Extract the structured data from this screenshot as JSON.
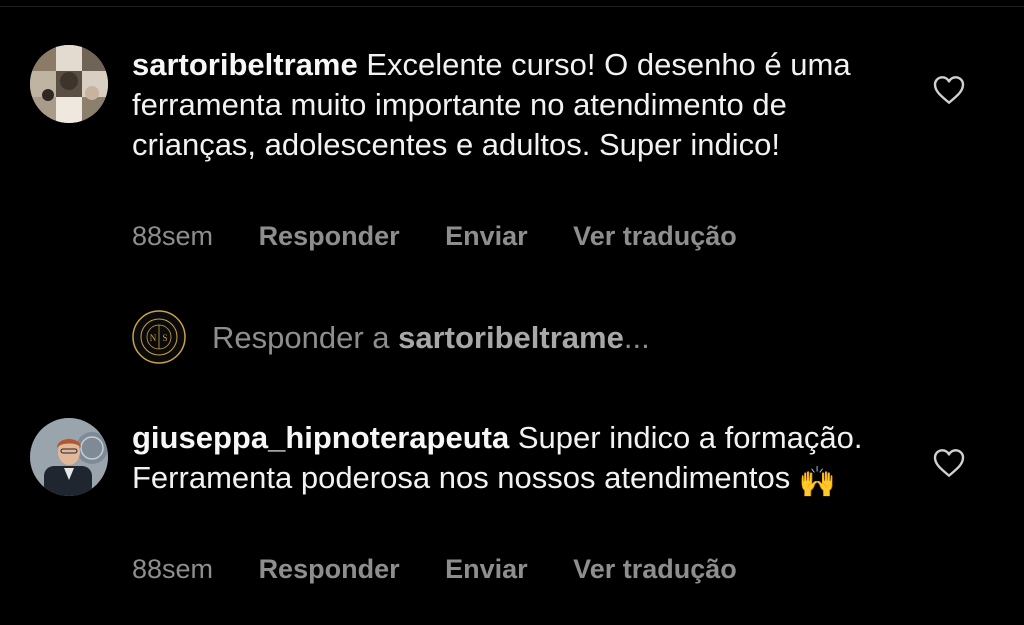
{
  "comments": [
    {
      "username": "sartoribeltrame",
      "text": "Excelente curso! O desenho é uma ferramenta muito importante no atendimento de crianças, adolescentes e adultos.  Super indico!",
      "time": "88sem",
      "reply_label": "Responder",
      "send_label": "Enviar",
      "translate_label": "Ver tradução",
      "avatar_icon": "profile-collage-avatar",
      "like_icon": "heart-outline-icon"
    },
    {
      "username": "giuseppa_hipnoterapeuta",
      "text": "Super indico a formação. Ferramenta poderosa nos nossos atendimentos",
      "emoji": "🙌",
      "time": "88sem",
      "reply_label": "Responder",
      "send_label": "Enviar",
      "translate_label": "Ver tradução",
      "avatar_icon": "profile-photo-avatar",
      "like_icon": "heart-outline-icon"
    }
  ],
  "reply_prompt": {
    "prefix": "Responder a ",
    "username": "sartoribeltrame",
    "suffix": "...",
    "logo_icon": "instituto-ns-logo-icon"
  },
  "colors": {
    "background": "#000000",
    "text": "#f2f2f2",
    "muted": "#8e8e8e",
    "logo_gold": "#c9a24a"
  }
}
